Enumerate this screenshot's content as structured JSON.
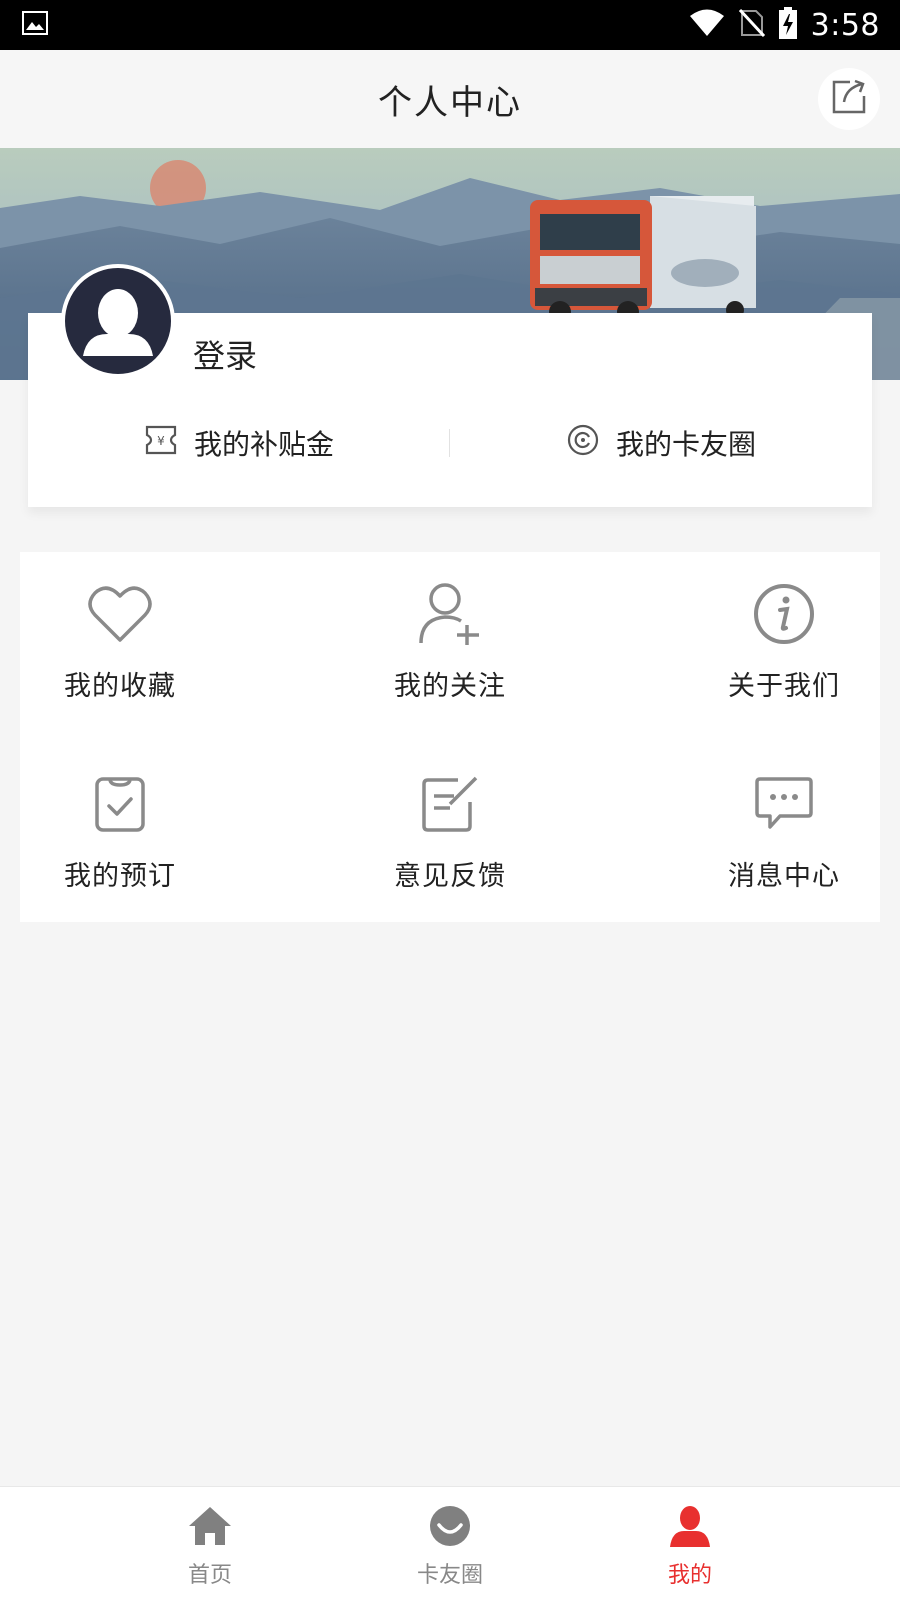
{
  "status_bar": {
    "time": "3:58"
  },
  "header": {
    "title": "个人中心"
  },
  "profile": {
    "login_label": "登录",
    "actions": [
      {
        "label": "我的补贴金",
        "icon": "subsidy-ticket-icon"
      },
      {
        "label": "我的卡友圈",
        "icon": "circle-icon"
      }
    ]
  },
  "menu": {
    "items": [
      {
        "label": "我的收藏",
        "icon": "heart-icon"
      },
      {
        "label": "我的关注",
        "icon": "add-user-icon"
      },
      {
        "label": "关于我们",
        "icon": "info-icon"
      },
      {
        "label": "我的预订",
        "icon": "clipboard-check-icon"
      },
      {
        "label": "意见反馈",
        "icon": "edit-note-icon"
      },
      {
        "label": "消息中心",
        "icon": "chat-bubble-icon"
      }
    ]
  },
  "bottom_nav": {
    "items": [
      {
        "label": "首页",
        "icon": "home-icon",
        "active": false
      },
      {
        "label": "卡友圈",
        "icon": "chat-circle-icon",
        "active": false
      },
      {
        "label": "我的",
        "icon": "person-icon",
        "active": true
      }
    ]
  },
  "colors": {
    "accent": "#e8302f",
    "avatar_bg": "#262a3e",
    "icon_gray": "#8a8a8a"
  }
}
